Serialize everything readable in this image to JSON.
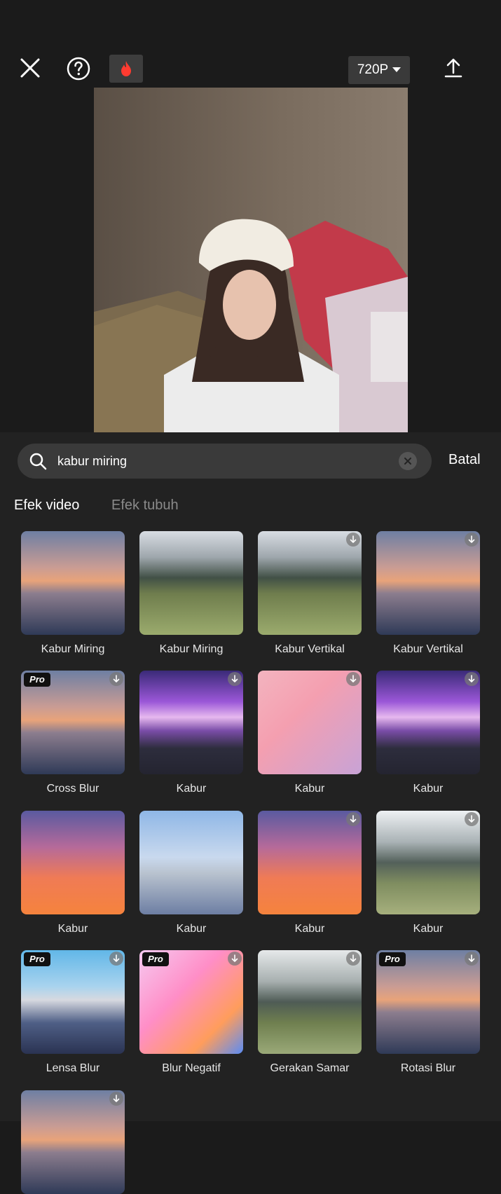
{
  "toolbar": {
    "resolution": "720P"
  },
  "search": {
    "query": "kabur miring",
    "cancel_label": "Batal"
  },
  "tabs": [
    {
      "label": "Efek video",
      "active": true
    },
    {
      "label": "Efek tubuh",
      "active": false
    }
  ],
  "effects": [
    {
      "label": "Kabur Miring",
      "pro": false,
      "download": false
    },
    {
      "label": "Kabur Miring",
      "pro": false,
      "download": false
    },
    {
      "label": "Kabur Vertikal",
      "pro": false,
      "download": true
    },
    {
      "label": "Kabur Vertikal",
      "pro": false,
      "download": true
    },
    {
      "label": "Cross Blur",
      "pro": true,
      "download": true
    },
    {
      "label": "Kabur",
      "pro": false,
      "download": true
    },
    {
      "label": "Kabur",
      "pro": false,
      "download": true
    },
    {
      "label": "Kabur",
      "pro": false,
      "download": true
    },
    {
      "label": "Kabur",
      "pro": false,
      "download": false
    },
    {
      "label": "Kabur",
      "pro": false,
      "download": false
    },
    {
      "label": "Kabur",
      "pro": false,
      "download": true
    },
    {
      "label": "Kabur",
      "pro": false,
      "download": true
    },
    {
      "label": "Lensa Blur",
      "pro": true,
      "download": true
    },
    {
      "label": "Blur Negatif",
      "pro": true,
      "download": true
    },
    {
      "label": "Gerakan Samar",
      "pro": false,
      "download": true
    },
    {
      "label": "Rotasi Blur",
      "pro": true,
      "download": true
    },
    {
      "label": "",
      "pro": false,
      "download": true
    }
  ],
  "pro_badge": "Pro"
}
